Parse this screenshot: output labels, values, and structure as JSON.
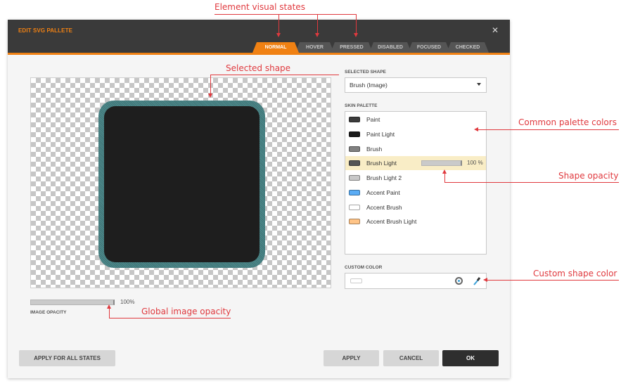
{
  "dialog": {
    "title": "EDIT SVG PALLETE",
    "close_icon": "close-icon",
    "tabs": [
      {
        "label": "NORMAL",
        "active": true
      },
      {
        "label": "HOVER",
        "active": false
      },
      {
        "label": "PRESSED",
        "active": false
      },
      {
        "label": "DISABLED",
        "active": false
      },
      {
        "label": "FOCUSED",
        "active": false
      },
      {
        "label": "CHECKED",
        "active": false
      }
    ],
    "accent_color": "#f08113"
  },
  "preview": {
    "shape_fill": "#1e1e1e",
    "shape_outline": "#4e8a8c"
  },
  "image_opacity": {
    "label": "IMAGE OPACITY",
    "value_text": "100%",
    "value": 100
  },
  "selected_shape": {
    "label": "SELECTED SHAPE",
    "value": "Brush (Image)"
  },
  "skin_palette": {
    "label": "SKIN PALETTE",
    "items": [
      {
        "name": "Paint",
        "color": "#3c3c3c"
      },
      {
        "name": "Paint Light",
        "color": "#1a1a1a"
      },
      {
        "name": "Brush",
        "color": "#808080"
      },
      {
        "name": "Brush Light",
        "color": "#555555",
        "selected": true,
        "opacity_text": "100 %",
        "opacity": 100
      },
      {
        "name": "Brush Light 2",
        "color": "#c8c8c8"
      },
      {
        "name": "Accent Paint",
        "color": "#5aacf5"
      },
      {
        "name": "Accent Brush",
        "color": "#ffffff"
      },
      {
        "name": "Accent Brush Light",
        "color": "#ffc487"
      }
    ]
  },
  "custom_color": {
    "label": "CUSTOM COLOR",
    "reset_icon": "reset-color-icon",
    "picker_icon": "eyedropper-icon"
  },
  "buttons": {
    "apply_all": "APPLY FOR ALL STATES",
    "apply": "APPLY",
    "cancel": "CANCEL",
    "ok": "OK"
  },
  "annotations": {
    "visual_states": "Element visual states",
    "selected_shape": "Selected shape",
    "common_palette": "Common palette colors",
    "shape_opacity": "Shape opacity",
    "custom_shape_color": "Custom shape color",
    "global_opacity": "Global image opacity"
  }
}
